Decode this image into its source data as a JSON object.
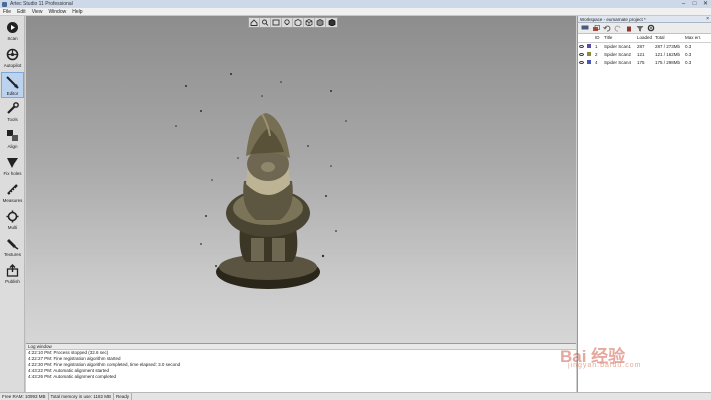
{
  "window": {
    "title": "Artec Studio 11 Professional",
    "controls": [
      "–",
      "□",
      "✕"
    ]
  },
  "menu": [
    "File",
    "Edit",
    "View",
    "Window",
    "Help"
  ],
  "tools": [
    {
      "label": "Scan",
      "icon": "scan-icon",
      "active": false
    },
    {
      "label": "Autopilot",
      "icon": "autopilot-icon",
      "active": false
    },
    {
      "label": "Editor",
      "icon": "editor-icon",
      "active": true
    },
    {
      "label": "Tools",
      "icon": "tools-icon",
      "active": false
    },
    {
      "label": "Align",
      "icon": "align-icon",
      "active": false
    },
    {
      "label": "Fix holes",
      "icon": "fix-holes-icon",
      "active": false
    },
    {
      "label": "Measures",
      "icon": "measures-icon",
      "active": false
    },
    {
      "label": "Multi",
      "icon": "multi-icon",
      "active": false
    },
    {
      "label": "Textures",
      "icon": "textures-icon",
      "active": false
    },
    {
      "label": "Publish",
      "icon": "publish-icon",
      "active": false
    }
  ],
  "workspace": {
    "title": "Workspace - eumarnate project *",
    "columns": [
      "",
      "ID",
      "Title",
      "Loaded",
      "Total",
      "Max err."
    ],
    "rows": [
      {
        "id": "1",
        "title": "Spider Scan1",
        "loaded": "287",
        "total": "287 / 273Mb",
        "max_err": "0.3",
        "color": "#5a4aa8"
      },
      {
        "id": "2",
        "title": "Spider Scan2",
        "loaded": "121",
        "total": "121 / 162Mb",
        "max_err": "0.3",
        "color": "#8a8a3a"
      },
      {
        "id": "4",
        "title": "Spider Scan4",
        "loaded": "175",
        "total": "175 / 298Mb",
        "max_err": "0.3",
        "color": "#4a5ab0"
      }
    ]
  },
  "log": {
    "title": "Log window",
    "lines": [
      "4:22:10 PM: Process stopped (32.6 sec)",
      "4:22:27 PM: Fine registration algorithm started",
      "4:22:30 PM: Fine registration algorithm completed, time elapsed: 3.0 second",
      "4:43:22 PM: Automatic alignment started",
      "4:43:26 PM: Automatic alignment completed"
    ]
  },
  "status": {
    "free_ram": "Free RAM: 10993 MB",
    "total_memory": "Total memory in use: 1182 MB",
    "state": "Ready"
  },
  "watermark": {
    "text": "Bai 经验",
    "sub": "jingyan.baidu.com"
  }
}
